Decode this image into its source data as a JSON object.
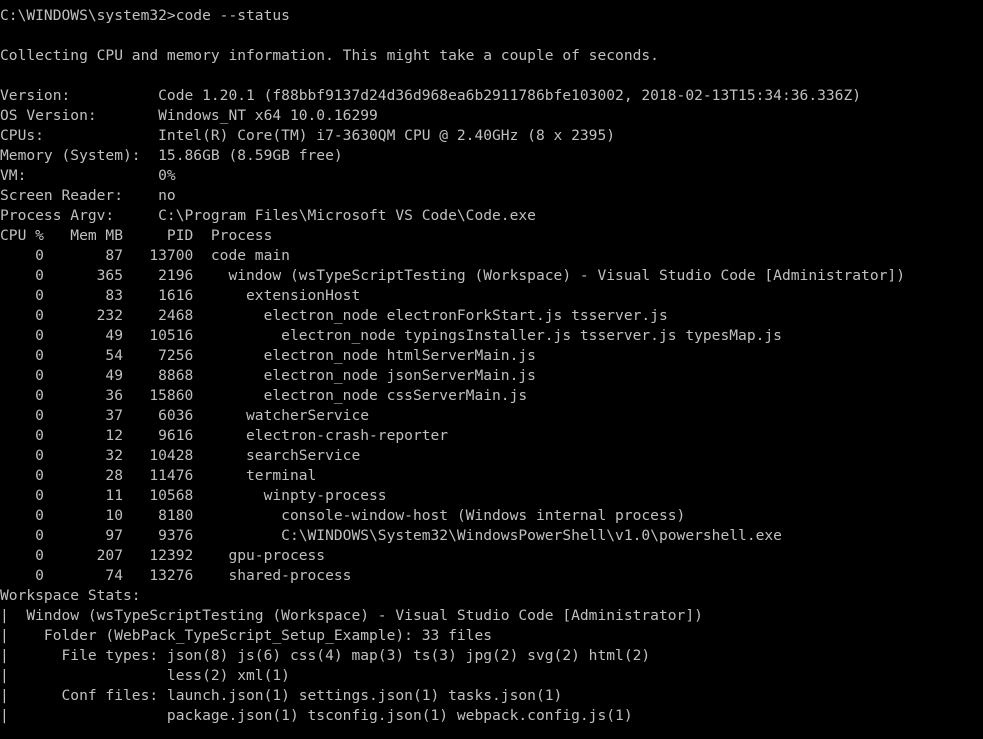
{
  "terminal": {
    "prompt": "C:\\WINDOWS\\system32>code --status",
    "collecting": "Collecting CPU and memory information. This might take a couple of seconds.",
    "info": {
      "version": "Version:          Code 1.20.1 (f88bbf9137d24d36d968ea6b2911786bfe103002, 2018-02-13T15:34:36.336Z)",
      "os_version": "OS Version:       Windows_NT x64 10.0.16299",
      "cpus": "CPUs:             Intel(R) Core(TM) i7-3630QM CPU @ 2.40GHz (8 x 2395)",
      "memory": "Memory (System):  15.86GB (8.59GB free)",
      "vm": "VM:               0%",
      "screen_reader": "Screen Reader:    no",
      "process_argv": "Process Argv:     C:\\Program Files\\Microsoft VS Code\\Code.exe"
    },
    "process_header": "CPU %   Mem MB     PID  Process",
    "process_rows": [
      "    0       87   13700  code main",
      "    0      365    2196    window (wsTypeScriptTesting (Workspace) - Visual Studio Code [Administrator])",
      "    0       83    1616      extensionHost",
      "    0      232    2468        electron_node electronForkStart.js tsserver.js",
      "    0       49   10516          electron_node typingsInstaller.js tsserver.js typesMap.js",
      "    0       54    7256        electron_node htmlServerMain.js",
      "    0       49    8868        electron_node jsonServerMain.js",
      "    0       36   15860        electron_node cssServerMain.js",
      "    0       37    6036      watcherService",
      "    0       12    9616      electron-crash-reporter",
      "    0       32   10428      searchService",
      "    0       28   11476      terminal",
      "    0       11   10568        winpty-process",
      "    0       10    8180          console-window-host (Windows internal process)",
      "    0       97    9376          C:\\WINDOWS\\System32\\WindowsPowerShell\\v1.0\\powershell.exe",
      "    0      207   12392    gpu-process",
      "    0       74   13276    shared-process"
    ],
    "workspace_stats": [
      "Workspace Stats:",
      "|  Window (wsTypeScriptTesting (Workspace) - Visual Studio Code [Administrator])",
      "|    Folder (WebPack_TypeScript_Setup_Example): 33 files",
      "|      File types: json(8) js(6) css(4) map(3) ts(3) jpg(2) svg(2) html(2)",
      "|                  less(2) xml(1)",
      "|      Conf files: launch.json(1) settings.json(1) tasks.json(1)",
      "|                  package.json(1) tsconfig.json(1) webpack.config.js(1)"
    ]
  }
}
